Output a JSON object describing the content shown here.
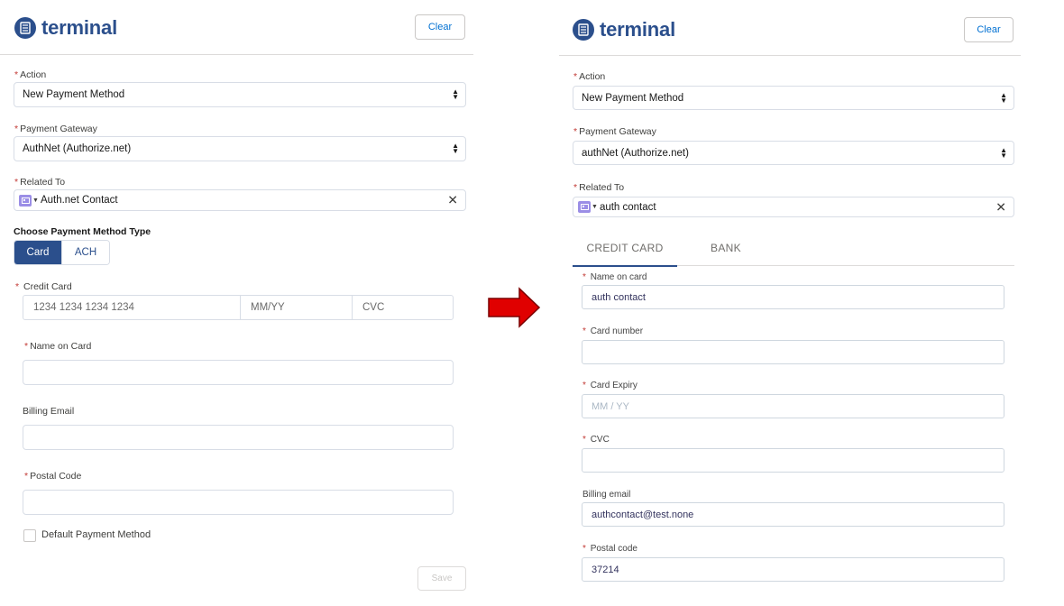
{
  "left": {
    "logo": "terminal",
    "clear_label": "Clear",
    "action": {
      "label": "Action",
      "value": "New Payment Method"
    },
    "gateway": {
      "label": "Payment Gateway",
      "value": "AuthNet (Authorize.net)"
    },
    "related": {
      "label": "Related To",
      "value": "Auth.net Contact"
    },
    "choose_type": "Choose Payment Method Type",
    "type_buttons": [
      "Card",
      "ACH"
    ],
    "credit_card": {
      "label": "Credit Card",
      "number_placeholder": "1234 1234 1234 1234",
      "expiry_placeholder": "MM/YY",
      "cvc_placeholder": "CVC"
    },
    "name_on_card": {
      "label": "Name on Card",
      "value": ""
    },
    "billing_email": {
      "label": "Billing Email",
      "value": ""
    },
    "postal_code": {
      "label": "Postal Code",
      "value": ""
    },
    "default_checkbox": "Default Payment Method",
    "save_label": "Save"
  },
  "right": {
    "logo": "terminal",
    "clear_label": "Clear",
    "action": {
      "label": "Action",
      "value": "New Payment Method"
    },
    "gateway": {
      "label": "Payment Gateway",
      "value": "authNet (Authorize.net)"
    },
    "related": {
      "label": "Related To",
      "value": "auth contact"
    },
    "tabs": [
      "CREDIT CARD",
      "BANK"
    ],
    "name_on_card": {
      "label": "Name on card",
      "value": "auth contact"
    },
    "card_number": {
      "label": "Card number",
      "value": ""
    },
    "card_expiry": {
      "label": "Card Expiry",
      "placeholder": "MM / YY"
    },
    "cvc": {
      "label": "CVC",
      "value": ""
    },
    "billing_email": {
      "label": "Billing email",
      "value": "authcontact@test.none"
    },
    "postal_code": {
      "label": "Postal code",
      "value": "37214"
    }
  },
  "colors": {
    "brand": "#2b4f8c",
    "required": "#c23934",
    "arrow": "#e00000",
    "lookup_icon": "#9b8ee6"
  },
  "icons": {
    "logo": "receipt-icon",
    "lookup": "contact-card-icon",
    "clear_field": "close-icon",
    "arrow": "right-arrow-icon"
  }
}
